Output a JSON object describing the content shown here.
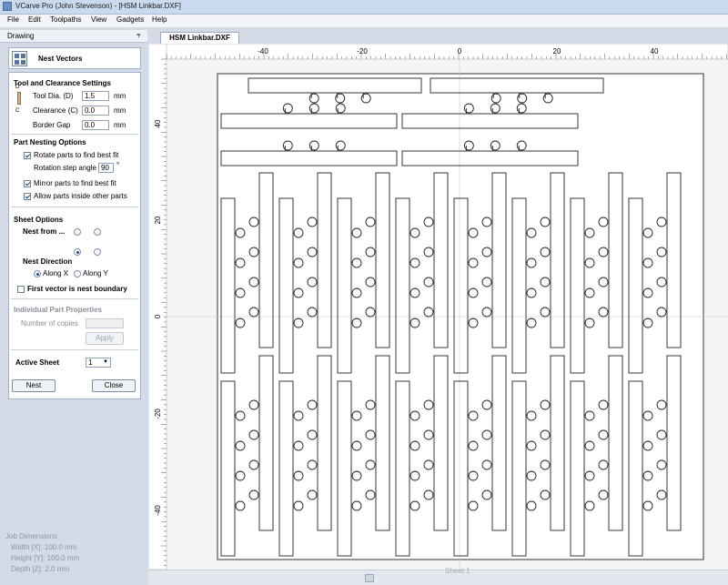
{
  "window": {
    "title": "VCarve Pro (John Stevenson) - [HSM Linkbar.DXF]"
  },
  "menu": [
    "File",
    "Edit",
    "Toolpaths",
    "View",
    "Gadgets",
    "Help"
  ],
  "panel": {
    "header": "Drawing",
    "pin_glyph": "⫧",
    "nest_title": "Nest Vectors",
    "tool_section": "Tool and Clearance Settings",
    "tool_diameter_label": "Tool Dia. (D)",
    "tool_diameter_value": "1.5",
    "clearance_label": "Clearance (C)",
    "clearance_value": "0.0",
    "border_gap_label": "Border Gap",
    "border_gap_value": "0.0",
    "unit": "mm",
    "tool_letters": {
      "d": "D",
      "c": "C"
    },
    "part_nesting": "Part Nesting Options",
    "rotate_label": "Rotate parts to find best fit",
    "rotate_checked": true,
    "rotation_step_label": "Rotation step angle",
    "rotation_step_value": "90",
    "degree": "°",
    "mirror_label": "Mirror parts to find best fit",
    "mirror_checked": true,
    "allow_inside_label": "Allow parts inside other parts",
    "allow_inside_checked": true,
    "sheet_options": "Sheet Options",
    "nest_from_label": "Nest from ...",
    "nest_from_selected": "bottom-left",
    "nest_direction_label": "Nest Direction",
    "along_x_label": "Along X",
    "along_y_label": "Along Y",
    "nest_direction_selected": "Along X",
    "first_vector_label": "First vector is nest boundary",
    "first_vector_checked": false,
    "individual_props": "Individual Part Properties",
    "copies_label": "Number of copies",
    "copies_value": "",
    "apply_label": "Apply",
    "active_sheet_label": "Active Sheet",
    "active_sheet_value": "1",
    "nest_button": "Nest",
    "close_button": "Close"
  },
  "job": {
    "title": "Job Dimensions",
    "width": "Width  [X]: 100.0 mm",
    "height": "Height [Y]: 100.0 mm",
    "depth": "Depth  [Z]: 2.0 mm"
  },
  "tab": {
    "label": "HSM Linkbar.DXF"
  },
  "ruler": {
    "top_labels": [
      "-40",
      "-20",
      "0",
      "20",
      "40"
    ],
    "left_labels": [
      "40",
      "20",
      "0",
      "-20",
      "-40"
    ]
  },
  "sheet": {
    "label": "Sheet 1"
  },
  "colors": {
    "accent": "#1d4b8f",
    "canvas": "#f5f5f5",
    "panel": "#d4dbe6"
  }
}
